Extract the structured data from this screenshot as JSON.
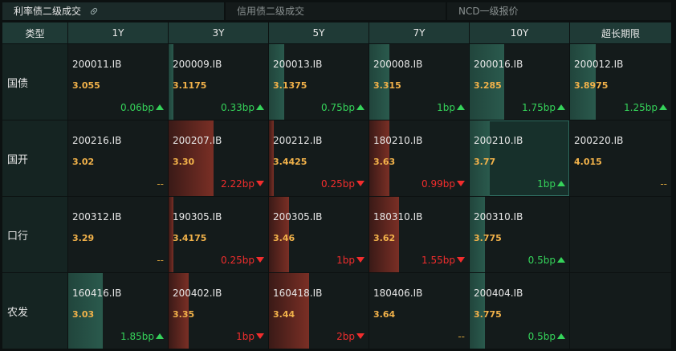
{
  "tabs": [
    {
      "label": "利率债二级成交",
      "active": true
    },
    {
      "label": "信用债二级成交",
      "active": false
    },
    {
      "label": "NCD一级报价",
      "active": false
    }
  ],
  "columns": [
    "类型",
    "1Y",
    "3Y",
    "5Y",
    "7Y",
    "10Y",
    "超长期限"
  ],
  "rows": [
    {
      "label": "国债",
      "cells": [
        {
          "code": "200011.IB",
          "price": "3.055",
          "change": "0.06bp",
          "dir": "up",
          "bar": 0.0
        },
        {
          "code": "200009.IB",
          "price": "3.1175",
          "change": "0.33bp",
          "dir": "up",
          "bar": 0.05
        },
        {
          "code": "200013.IB",
          "price": "3.1375",
          "change": "0.75bp",
          "dir": "up",
          "bar": 0.15
        },
        {
          "code": "200008.IB",
          "price": "3.315",
          "change": "1bp",
          "dir": "up",
          "bar": 0.2
        },
        {
          "code": "200016.IB",
          "price": "3.285",
          "change": "1.75bp",
          "dir": "up",
          "bar": 0.35
        },
        {
          "code": "200012.IB",
          "price": "3.8975",
          "change": "1.25bp",
          "dir": "up",
          "bar": 0.25
        }
      ]
    },
    {
      "label": "国开",
      "cells": [
        {
          "code": "200216.IB",
          "price": "3.02",
          "change": "--",
          "dir": "flat",
          "bar": 0.0
        },
        {
          "code": "200207.IB",
          "price": "3.30",
          "change": "2.22bp",
          "dir": "down",
          "bar": 0.45
        },
        {
          "code": "200212.IB",
          "price": "3.4425",
          "change": "0.25bp",
          "dir": "down",
          "bar": 0.05
        },
        {
          "code": "180210.IB",
          "price": "3.63",
          "change": "0.99bp",
          "dir": "down",
          "bar": 0.2
        },
        {
          "code": "200210.IB",
          "price": "3.77",
          "change": "1bp",
          "dir": "up",
          "bar": 0.2,
          "selected": true
        },
        {
          "code": "200220.IB",
          "price": "4.015",
          "change": "--",
          "dir": "flat",
          "bar": 0.0
        }
      ]
    },
    {
      "label": "口行",
      "cells": [
        {
          "code": "200312.IB",
          "price": "3.29",
          "change": "--",
          "dir": "flat",
          "bar": 0.0
        },
        {
          "code": "190305.IB",
          "price": "3.4175",
          "change": "0.25bp",
          "dir": "down",
          "bar": 0.05
        },
        {
          "code": "200305.IB",
          "price": "3.46",
          "change": "1bp",
          "dir": "down",
          "bar": 0.2
        },
        {
          "code": "180310.IB",
          "price": "3.62",
          "change": "1.55bp",
          "dir": "down",
          "bar": 0.3
        },
        {
          "code": "200310.IB",
          "price": "3.775",
          "change": "0.5bp",
          "dir": "up",
          "bar": 0.15
        },
        null
      ]
    },
    {
      "label": "农发",
      "cells": [
        {
          "code": "160416.IB",
          "price": "3.03",
          "change": "1.85bp",
          "dir": "up",
          "bar": 0.35
        },
        {
          "code": "200402.IB",
          "price": "3.35",
          "change": "1bp",
          "dir": "down",
          "bar": 0.2
        },
        {
          "code": "160418.IB",
          "price": "3.44",
          "change": "2bp",
          "dir": "down",
          "bar": 0.4
        },
        {
          "code": "180406.IB",
          "price": "3.64",
          "change": "--",
          "dir": "flat",
          "bar": 0.0
        },
        {
          "code": "200404.IB",
          "price": "3.775",
          "change": "0.5bp",
          "dir": "up",
          "bar": 0.15
        },
        null
      ]
    }
  ],
  "colors": {
    "up": "#35d35a",
    "down": "#f22d2d",
    "price": "#f2b24a",
    "header_bg": "#1f3a36"
  }
}
